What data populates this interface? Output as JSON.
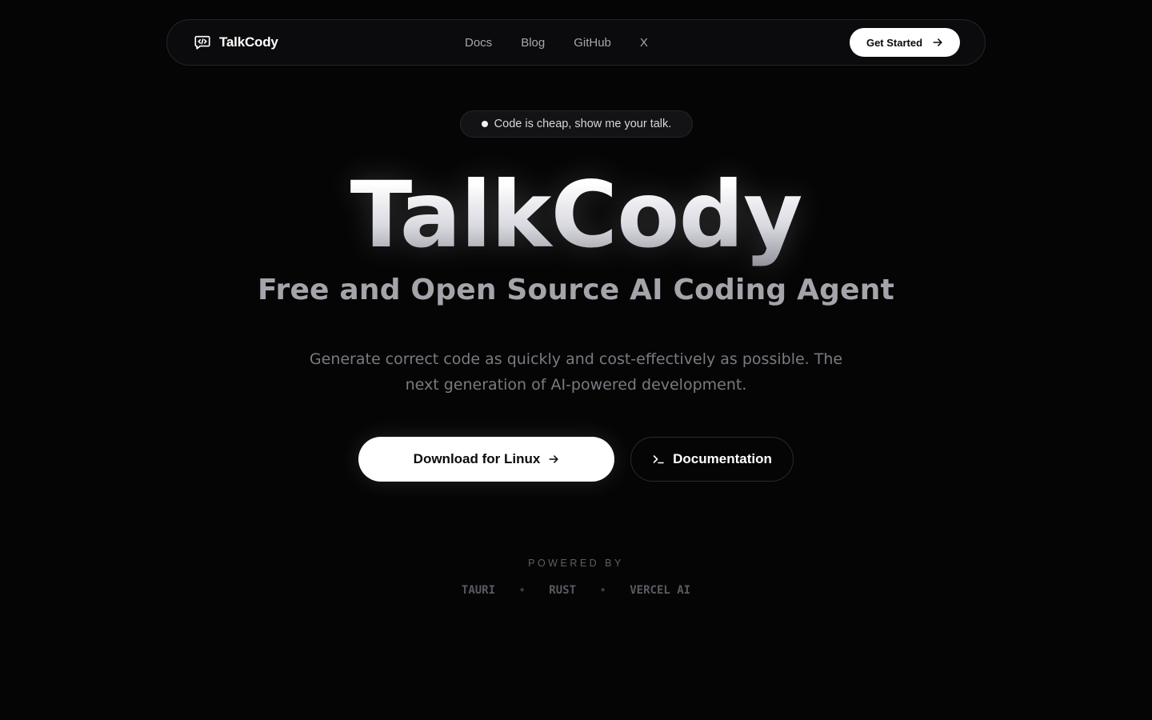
{
  "nav": {
    "brand": {
      "name": "TalkCody",
      "icon": "chat-code-icon"
    },
    "links": [
      {
        "label": "Docs"
      },
      {
        "label": "Blog"
      },
      {
        "label": "GitHub"
      },
      {
        "label": "X"
      }
    ],
    "cta": {
      "label": "Get Started",
      "icon": "arrow-right-icon"
    }
  },
  "hero": {
    "tagline": "Code is cheap, show me your talk.",
    "title": "TalkCody",
    "subtitle": "Free and Open Source AI Coding Agent",
    "description": "Generate correct code as quickly and cost-effectively as possible. The next generation of AI-powered development.",
    "primary_button": {
      "label": "Download for Linux",
      "icon": "arrow-right-icon"
    },
    "secondary_button": {
      "label": "Documentation",
      "icon": "terminal-icon"
    }
  },
  "powered_by": {
    "label": "POWERED BY",
    "items": [
      "TAURI",
      "RUST",
      "VERCEL AI"
    ],
    "separator": "•"
  },
  "colors": {
    "background": "#050506",
    "nav_background": "#0b0b0d",
    "primary_button": "#ffffff",
    "muted_text": "#7a7a80"
  }
}
